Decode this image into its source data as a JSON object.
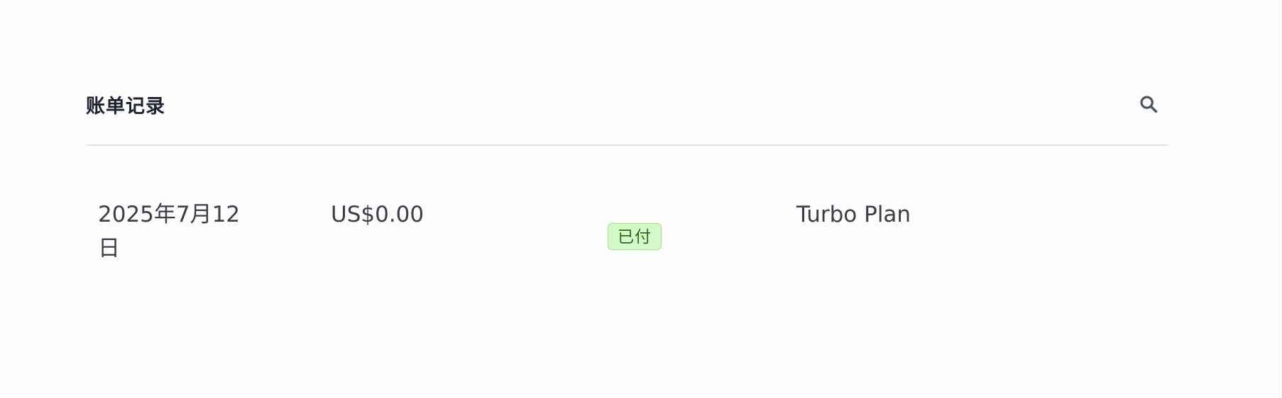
{
  "billing": {
    "title": "账单记录",
    "search_icon": "search-icon",
    "rows": [
      {
        "date": "2025年7月12日",
        "amount": "US$0.00",
        "status": "已付",
        "plan": "Turbo Plan"
      }
    ]
  },
  "colors": {
    "status_paid_bg": "#d4f8c7",
    "status_paid_text": "#2b6a16"
  }
}
